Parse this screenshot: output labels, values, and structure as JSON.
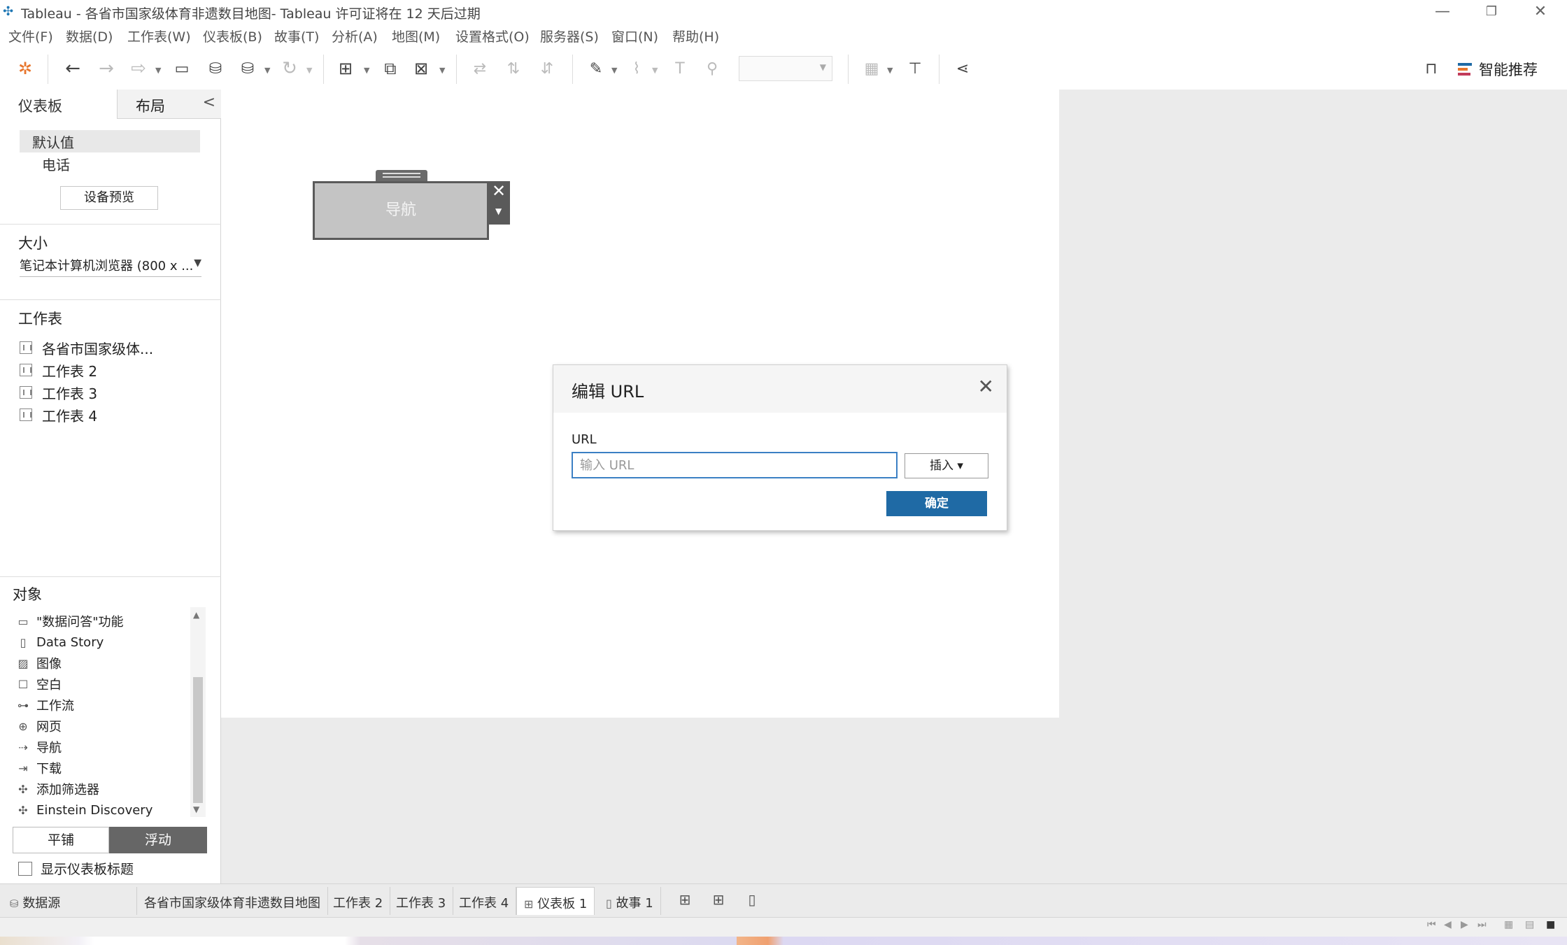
{
  "window": {
    "title": "Tableau - 各省市国家级体育非遗数目地图- Tableau 许可证将在 12 天后过期",
    "minimize": "—",
    "restore": "❐",
    "close": "✕"
  },
  "menu": [
    "文件(F)",
    "数据(D)",
    "工作表(W)",
    "仪表板(B)",
    "故事(T)",
    "分析(A)",
    "地图(M)",
    "设置格式(O)",
    "服务器(S)",
    "窗口(N)",
    "帮助(H)"
  ],
  "toolbar": {
    "smart_label": "智能推荐",
    "accent": "#1f6aa5"
  },
  "leftpane": {
    "tab_dashboard": "仪表板",
    "tab_layout": "布局",
    "collapse": "<",
    "device_default": "默认值",
    "device_phone": "电话",
    "device_preview": "设备预览",
    "size_title": "大小",
    "size_value": "笔记本计算机浏览器 (800 x ...",
    "sheets_title": "工作表",
    "sheets": [
      "各省市国家级体...",
      "工作表 2",
      "工作表 3",
      "工作表 4"
    ],
    "objects_title": "对象",
    "objects": [
      {
        "icon": "speech-bubble-icon",
        "label": "\"数据问答\"功能"
      },
      {
        "icon": "book-icon",
        "label": "Data Story"
      },
      {
        "icon": "image-icon",
        "label": "图像"
      },
      {
        "icon": "blank-icon",
        "label": "空白"
      },
      {
        "icon": "workflow-icon",
        "label": "工作流"
      },
      {
        "icon": "globe-icon",
        "label": "网页"
      },
      {
        "icon": "navigation-icon",
        "label": "导航"
      },
      {
        "icon": "download-icon",
        "label": "下载"
      },
      {
        "icon": "extension-icon",
        "label": "添加筛选器"
      },
      {
        "icon": "extension-icon",
        "label": "Einstein Discovery"
      }
    ],
    "tiled": "平铺",
    "floating": "浮动",
    "show_title": "显示仪表板标题"
  },
  "canvas": {
    "nav_label": "导航"
  },
  "dialog": {
    "title": "编辑 URL",
    "url_label": "URL",
    "url_placeholder": "输入 URL",
    "insert": "插入 ▾",
    "ok": "确定"
  },
  "sheettabs": {
    "datasource": "数据源",
    "tabs": [
      "各省市国家级体育非遗数目地图",
      "工作表 2",
      "工作表 3",
      "工作表 4"
    ],
    "dashboard": "仪表板 1",
    "story": "故事 1"
  }
}
